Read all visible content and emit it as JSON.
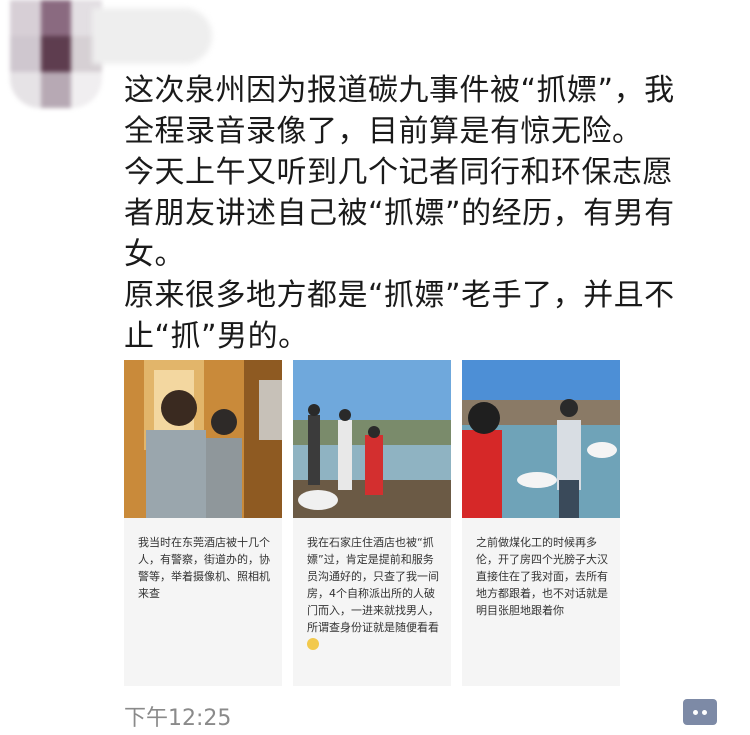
{
  "post": {
    "text": "这次泉州因为报道碳九事件被“抓嫖”，我\n全程录音录像了，目前算是有惊无险。\n今天上午又听到几个记者同行和环保志愿\n者朋友讲述自己被“抓嫖”的经历，有男有\n女。\n原来很多地方都是“抓嫖”老手了，并且不\n止“抓”男的。",
    "time": "下午12:25"
  },
  "cards": [
    {
      "caption": "我当时在东莞酒店被十几个人，有警察，街道办的，协警等，举着摄像机、照相机来查"
    },
    {
      "caption": "我在石家庄住酒店也被“抓嫖”过，肯定是提前和服务员沟通好的，只查了我一间房，4个自称派出所的人破门而入，一进来就找男人，所谓查身份证就是随便看看"
    },
    {
      "caption": "之前做煤化工的时候再多伦，开了房四个光膀子大汉直接住在了我对面，去所有地方都跟着，也不对话就是明目张胆地跟着你"
    }
  ],
  "icons": {
    "comment": "comment-dots-icon",
    "emoji": "smile-emoji-icon"
  }
}
